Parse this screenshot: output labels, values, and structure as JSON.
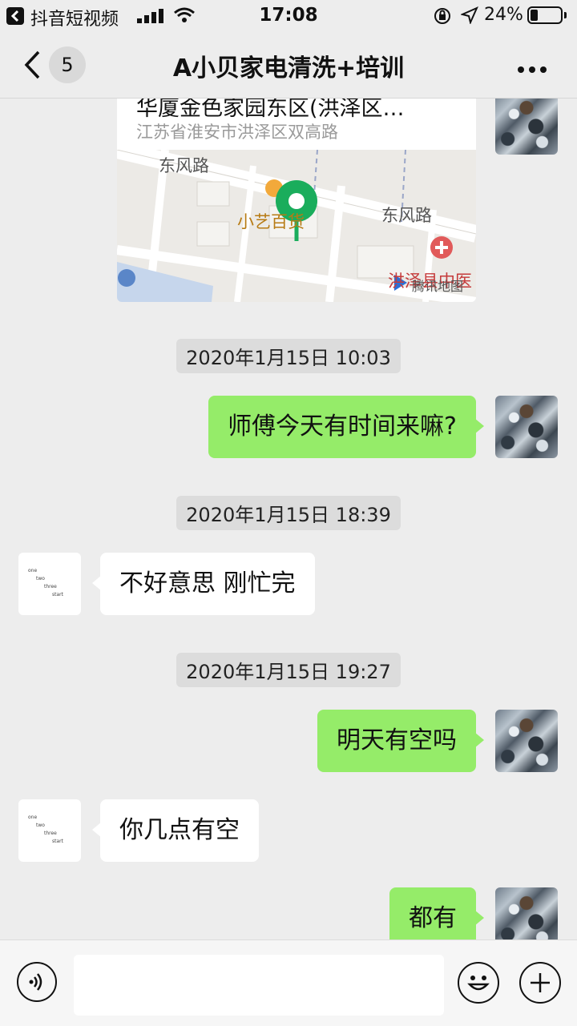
{
  "status_bar": {
    "app_name": "抖音短视频",
    "time": "17:08",
    "battery": "24%",
    "battery_level": 0.24
  },
  "nav": {
    "unread_count": "5",
    "title": "A小贝家电清洗+培训"
  },
  "location_card": {
    "title": "华厦金色家园东区(洪泽区…",
    "address": "江苏省淮安市洪泽区双高路",
    "map_labels": {
      "road_1": "东风路",
      "road_2": "东风路",
      "shop": "小艺百货",
      "hospital": "洪泽县中医",
      "provider": "腾讯地图"
    }
  },
  "messages": [
    {
      "type": "time",
      "text": "2020年1月15日 10:03"
    },
    {
      "type": "mine",
      "text": "师傅今天有时间来嘛?"
    },
    {
      "type": "time",
      "text": "2020年1月15日 18:39"
    },
    {
      "type": "theirs",
      "text": "不好意思 刚忙完"
    },
    {
      "type": "time",
      "text": "2020年1月15日 19:27"
    },
    {
      "type": "mine",
      "text": "明天有空吗"
    },
    {
      "type": "theirs",
      "text": "你几点有空"
    },
    {
      "type": "mine",
      "text": "都有"
    }
  ],
  "contact_avatar": {
    "lines": [
      "one",
      "two",
      "three",
      "start"
    ]
  },
  "input": {
    "value": "",
    "placeholder": ""
  }
}
